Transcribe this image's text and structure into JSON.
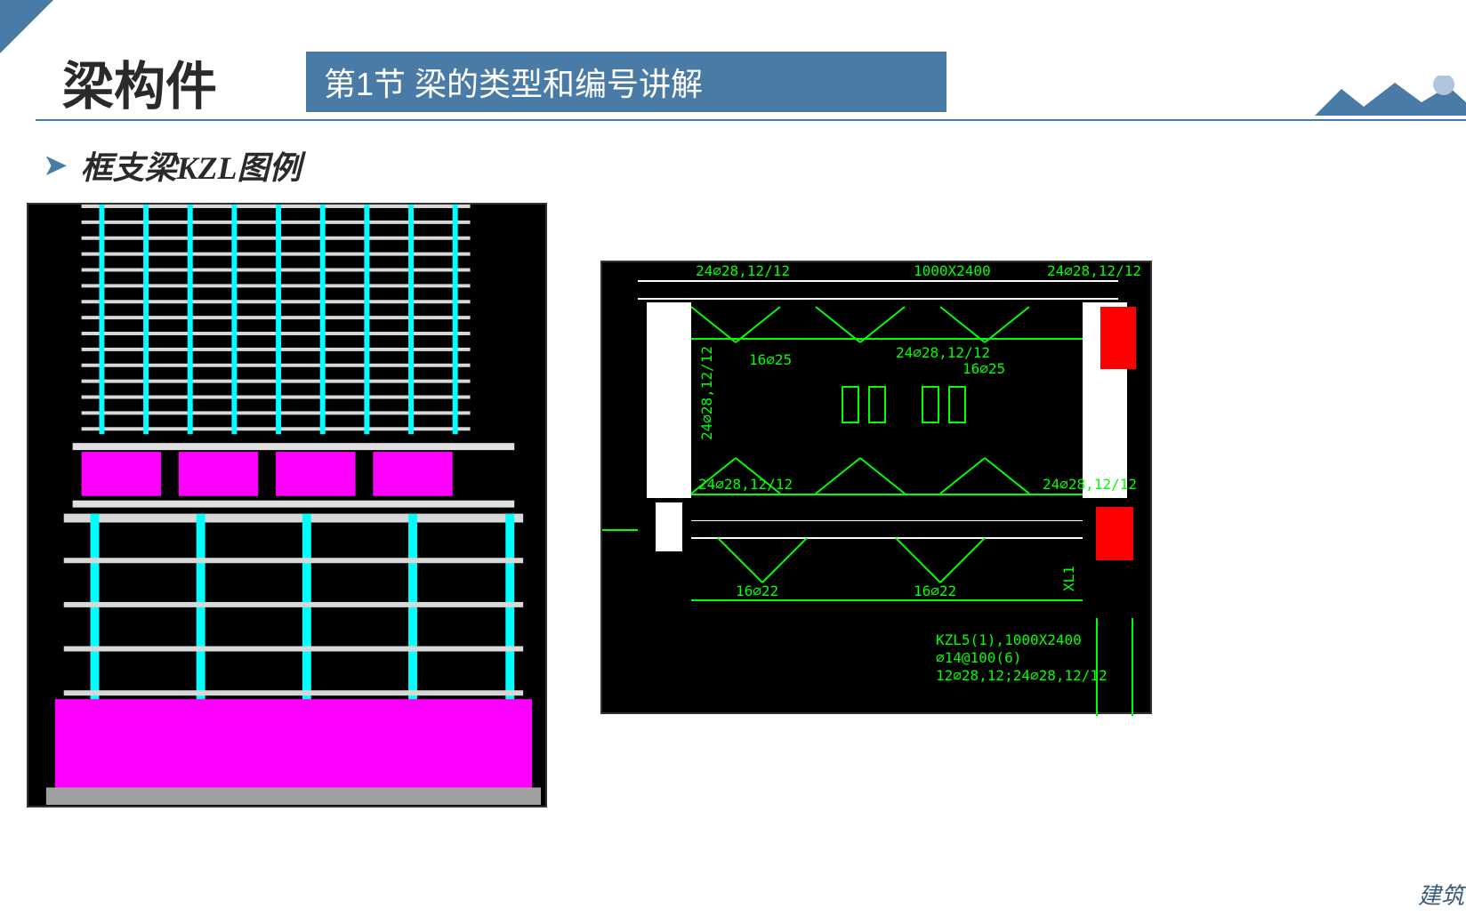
{
  "header": {
    "main_title": "梁构件",
    "section_banner": "第1节 梁的类型和编号讲解"
  },
  "subtitle": {
    "bullet": "➤",
    "text": "框支梁KZL图例"
  },
  "cad_drawing": {
    "annotations": {
      "top_left": "24⌀28,12/12",
      "top_mid": "1000X2400",
      "top_right": "24⌀28,12/12",
      "side_rotated": "24⌀28,12/12",
      "mid_left_a": "16⌀25",
      "mid_center": "24⌀28,12/12",
      "mid_right_a": "16⌀25",
      "mid_left_b": "24⌀28,12/12",
      "mid_right_b": "24⌀28,12/12",
      "bottom_left": "16⌀22",
      "bottom_right": "16⌀22",
      "xl_label": "XL1",
      "info_line1": "KZL5(1),1000X2400",
      "info_line2": "⌀14@100(6)",
      "info_line3": "12⌀28,12;24⌀28,12/12"
    }
  },
  "watermark": "建筑"
}
